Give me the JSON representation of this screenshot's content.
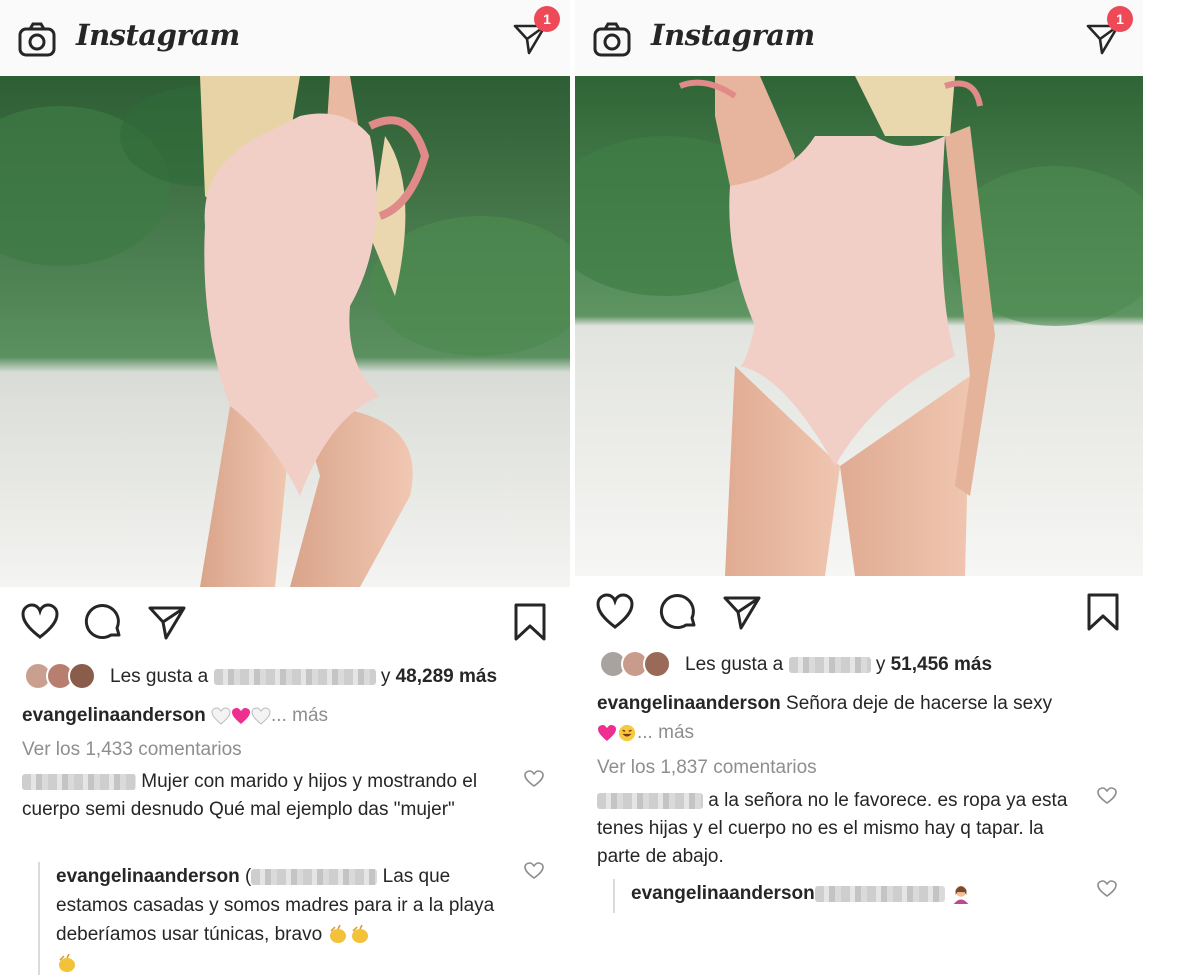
{
  "app": {
    "brand": "Instagram",
    "notification_count": "1"
  },
  "posts": [
    {
      "likes": {
        "prefix": "Les gusta a",
        "connector": "y",
        "count_text": "48,289 más"
      },
      "caption": {
        "username": "evangelinaanderson",
        "text": "",
        "more": "... más"
      },
      "view_comments": "Ver los 1,433 comentarios",
      "comment": {
        "text": "Mujer con marido y hijos y mostrando el cuerpo semi desnudo Qué mal ejemplo das \"mujer\""
      },
      "reply": {
        "username": "evangelinaanderson",
        "open_paren": "(",
        "text": "Las que estamos casadas y somos madres para ir a la playa deberíamos usar túnicas, bravo"
      }
    },
    {
      "likes": {
        "prefix": "Les gusta a",
        "connector": "y",
        "count_text": "51,456 más"
      },
      "caption": {
        "username": "evangelinaanderson",
        "text": "Señora deje de hacerse la sexy",
        "more": "... más"
      },
      "view_comments": "Ver los 1,837 comentarios",
      "comment": {
        "text": "a la señora no le favorece. es ropa ya esta tenes hijas y el cuerpo no es el mismo hay q tapar. la parte de abajo."
      },
      "reply": {
        "username": "evangelinaanderson",
        "text": ""
      }
    }
  ],
  "colors": {
    "badge": "#ed4956",
    "muted": "#8e8e8e",
    "text": "#262626",
    "swimsuit": "#f2cfc6",
    "greenery": "#3f7a46",
    "sand": "#eeeeea"
  },
  "icons": [
    "camera-icon",
    "direct-message-icon",
    "heart-icon",
    "comment-icon",
    "share-icon",
    "bookmark-icon"
  ]
}
